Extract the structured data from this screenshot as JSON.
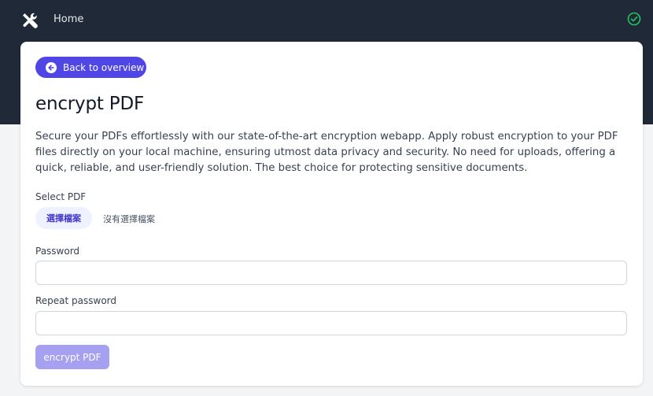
{
  "nav": {
    "logo_icon": "tools-icon",
    "home_label": "Home",
    "status_icon": "check-circle-icon",
    "status_color": "#22c55e"
  },
  "colors": {
    "header_bg": "#1f2937",
    "accent": "#4f46e5",
    "disabled_button": "#a5a0f0"
  },
  "main": {
    "back_label": "Back to overview",
    "back_icon": "arrow-left-circle-icon",
    "title": "encrypt PDF",
    "description": "Secure your PDFs effortlessly with our state-of-the-art encryption webapp. Apply robust encryption to your PDF files directly on your local machine, ensuring utmost data privacy and security. No need for uploads, offering a quick, reliable, and user-friendly solution. The best choice for protecting sensitive documents.",
    "select_pdf_label": "Select PDF",
    "file_button_label": "選擇檔案",
    "file_status": "沒有選擇檔案",
    "password_label": "Password",
    "password_value": "",
    "repeat_password_label": "Repeat password",
    "repeat_password_value": "",
    "submit_label": "encrypt PDF"
  }
}
